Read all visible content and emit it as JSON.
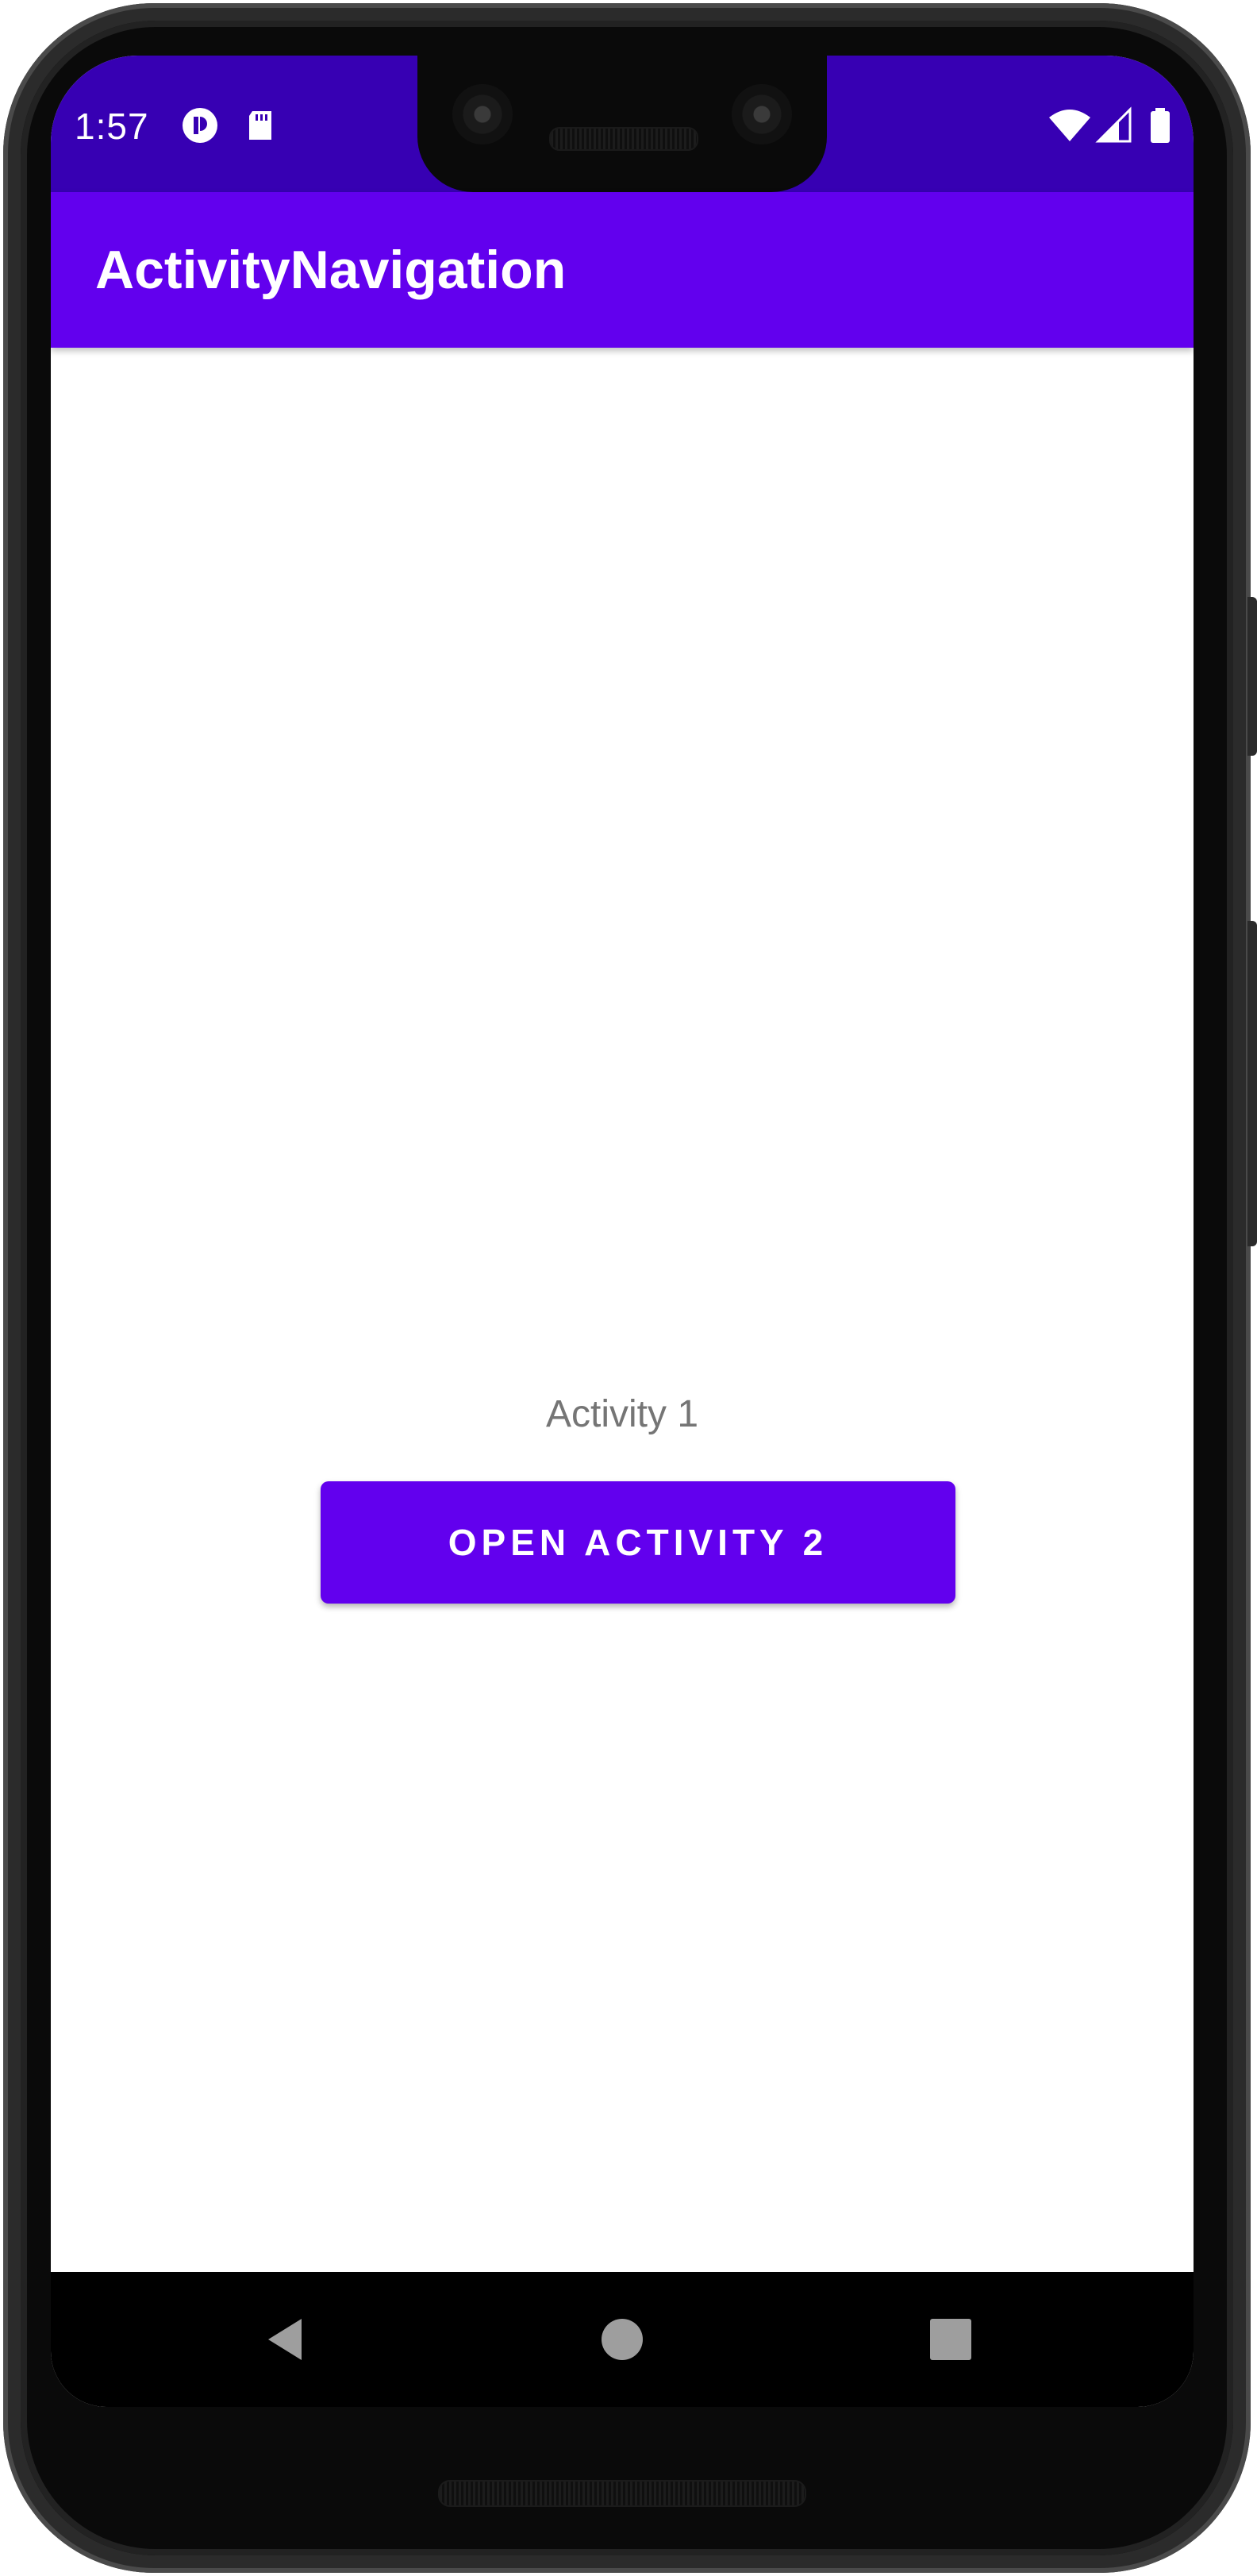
{
  "status_bar": {
    "time": "1:57",
    "background_color": "#3700b3",
    "left_icons": [
      "cast-icon",
      "sd-card-icon"
    ],
    "right_icons": [
      "wifi-icon",
      "cellular-signal-icon",
      "battery-icon"
    ]
  },
  "app_bar": {
    "title": "ActivityNavigation",
    "background_color": "#6200ee"
  },
  "content": {
    "label": "Activity 1",
    "button_label": "OPEN ACTIVITY 2",
    "button_color": "#6200ee"
  },
  "nav_bar": {
    "buttons": [
      "back-icon",
      "home-icon",
      "recents-icon"
    ]
  }
}
